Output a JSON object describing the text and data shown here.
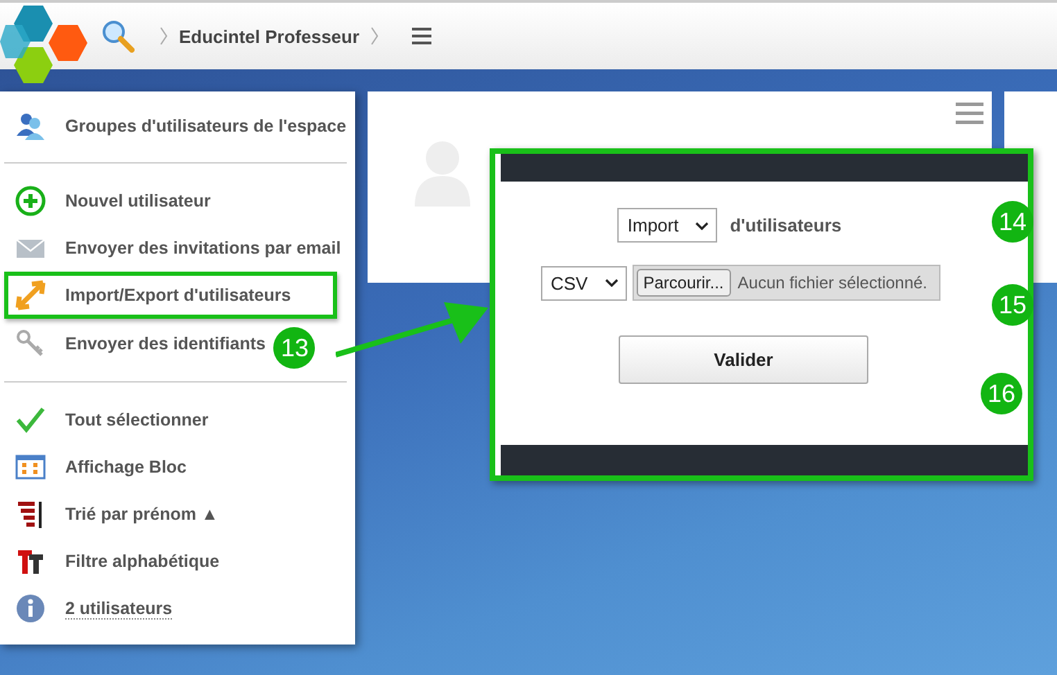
{
  "header": {
    "title": "Educintel Professeur"
  },
  "menu": {
    "sections": [
      {
        "items": [
          {
            "label": "Groupes d'utilisateurs de l'espace",
            "highlighted": false,
            "link": false
          }
        ]
      },
      {
        "items": [
          {
            "label": "Nouvel utilisateur",
            "highlighted": false,
            "link": false
          },
          {
            "label": "Envoyer des invitations par email",
            "highlighted": false,
            "link": false
          },
          {
            "label": "Import/Export d'utilisateurs",
            "highlighted": true,
            "link": false
          },
          {
            "label": "Envoyer des identifiants",
            "highlighted": false,
            "link": false,
            "badge": "13"
          }
        ]
      },
      {
        "items": [
          {
            "label": "Tout sélectionner",
            "highlighted": false,
            "link": false
          },
          {
            "label": "Affichage Bloc",
            "highlighted": false,
            "link": false
          },
          {
            "label": "Trié par prénom ▲",
            "highlighted": false,
            "link": false
          },
          {
            "label": "Filtre alphabétique",
            "highlighted": false,
            "link": false
          },
          {
            "label": "2 utilisateurs",
            "highlighted": false,
            "link": true
          }
        ]
      }
    ]
  },
  "dialog": {
    "mode_select": "Import",
    "mode_label": "d'utilisateurs",
    "format_select": "CSV",
    "browse_button": "Parcourir...",
    "file_status": "Aucun fichier sélectionné.",
    "submit_button": "Valider",
    "badges": [
      "14",
      "15",
      "16"
    ]
  }
}
